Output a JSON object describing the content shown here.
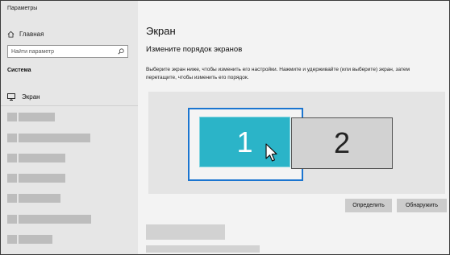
{
  "app": {
    "title": "Параметры"
  },
  "sidebar": {
    "home_label": "Главная",
    "search_placeholder": "Найти параметр",
    "section_label": "Система",
    "active_item_label": "Экран",
    "blurred_item_count": 9
  },
  "main": {
    "title": "Экран",
    "subtitle": "Измените порядок экранов",
    "description": "Выберите экран ниже, чтобы изменить его настройки. Нажмите и удерживайте (или выберите) экран, затем перетащите, чтобы изменить его порядок.",
    "monitors": [
      {
        "label": "1",
        "selected": true
      },
      {
        "label": "2",
        "selected": false
      }
    ],
    "buttons": {
      "detect": "Определить",
      "identify": "Обнаружить"
    }
  },
  "colors": {
    "accent_selection": "#1b75d0",
    "monitor_selected": "#2bb4c8",
    "monitor_other": "#d2d2d2",
    "sidebar_bg": "#e6e6e6"
  }
}
